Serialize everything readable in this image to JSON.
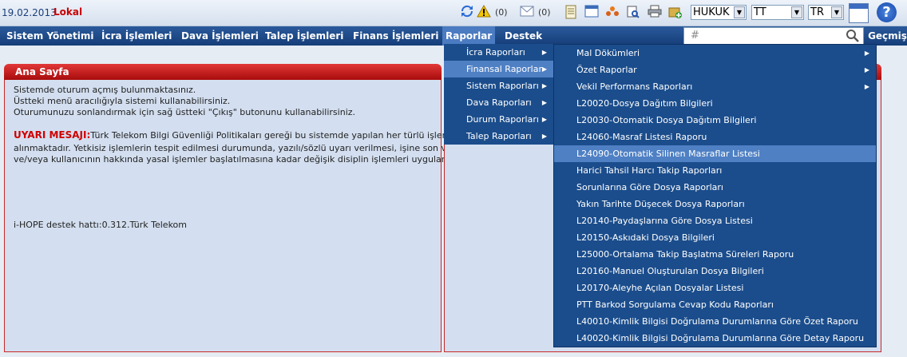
{
  "header": {
    "date": "19.02.2013",
    "env": "Lokal",
    "alerts_count": "(0)",
    "messages_count": "(0)",
    "module_select": "HUKUK",
    "sub_select": "TT",
    "lang_select": "TR",
    "help_label": "?"
  },
  "nav": {
    "items": [
      "Sistem Yönetimi",
      "İcra İşlemleri",
      "Dava İşlemleri",
      "Talep İşlemleri",
      "Finans İşlemleri",
      "Raporlar",
      "Destek"
    ],
    "search_placeholder": "#",
    "history_label": "Geçmiş"
  },
  "home": {
    "title": "Ana Sayfa",
    "line1": "Sistemde oturum açmış bulunmaktasınız.",
    "line2": "Üstteki menü aracılığıyla sistemi kullanabilirsiniz.",
    "line3": "Oturumunuzu sonlandırmak için sağ üstteki \"Çıkış\" butonunu kullanabilirsiniz.",
    "warning_label": "UYARI MESAJI:",
    "warning_text1": "Türk Telekom Bilgi Güvenliği Politikaları gereği bu sistemde yapılan her türlü işlem kayıt altına",
    "warning_text2": "alınmaktadır. Yetkisiz işlemlerin tespit edilmesi durumunda, yazılı/sözlü uyarı verilmesi, işine son verilmesi",
    "warning_text3": "ve/veya kullanıcının hakkında yasal işlemler başlatılmasına kadar değişik disiplin işlemleri uygulanabilir!",
    "support": "i-HOPE destek hattı:0.312.Türk Telekom"
  },
  "reports_menu": {
    "items": [
      "İcra Raporları",
      "Finansal Raporlar",
      "Sistem Raporları",
      "Dava Raporları",
      "Durum Raporları",
      "Talep Raporları"
    ],
    "highlighted": 1
  },
  "finance_menu": {
    "items": [
      "Mal Dökümleri",
      "Özet Raporlar",
      "Vekil Performans Raporları",
      "L20020-Dosya Dağıtım Bilgileri",
      "L20030-Otomatik Dosya Dağıtım Bilgileri",
      "L24060-Masraf Listesi Raporu",
      "L24090-Otomatik Silinen Masraflar Listesi",
      "Harici Tahsil Harcı Takip Raporları",
      "Sorunlarına Göre Dosya Raporları",
      "Yakın Tarihte Düşecek Dosya Raporları",
      "L20140-Paydaşlarına Göre Dosya Listesi",
      "L20150-Askıdaki Dosya Bilgileri",
      "L25000-Ortalama Takip Başlatma Süreleri Raporu",
      "L20160-Manuel Oluşturulan Dosya Bilgileri",
      "L20170-Aleyhe Açılan Dosyalar Listesi",
      "PTT Barkod Sorgulama Cevap Kodu Raporları",
      "L40010-Kimlik Bilgisi Doğrulama Durumlarına Göre Özet Raporu",
      "L40020-Kimlik Bilgisi Doğrulama Durumlarına Göre Detay Raporu"
    ],
    "highlighted": 6
  }
}
